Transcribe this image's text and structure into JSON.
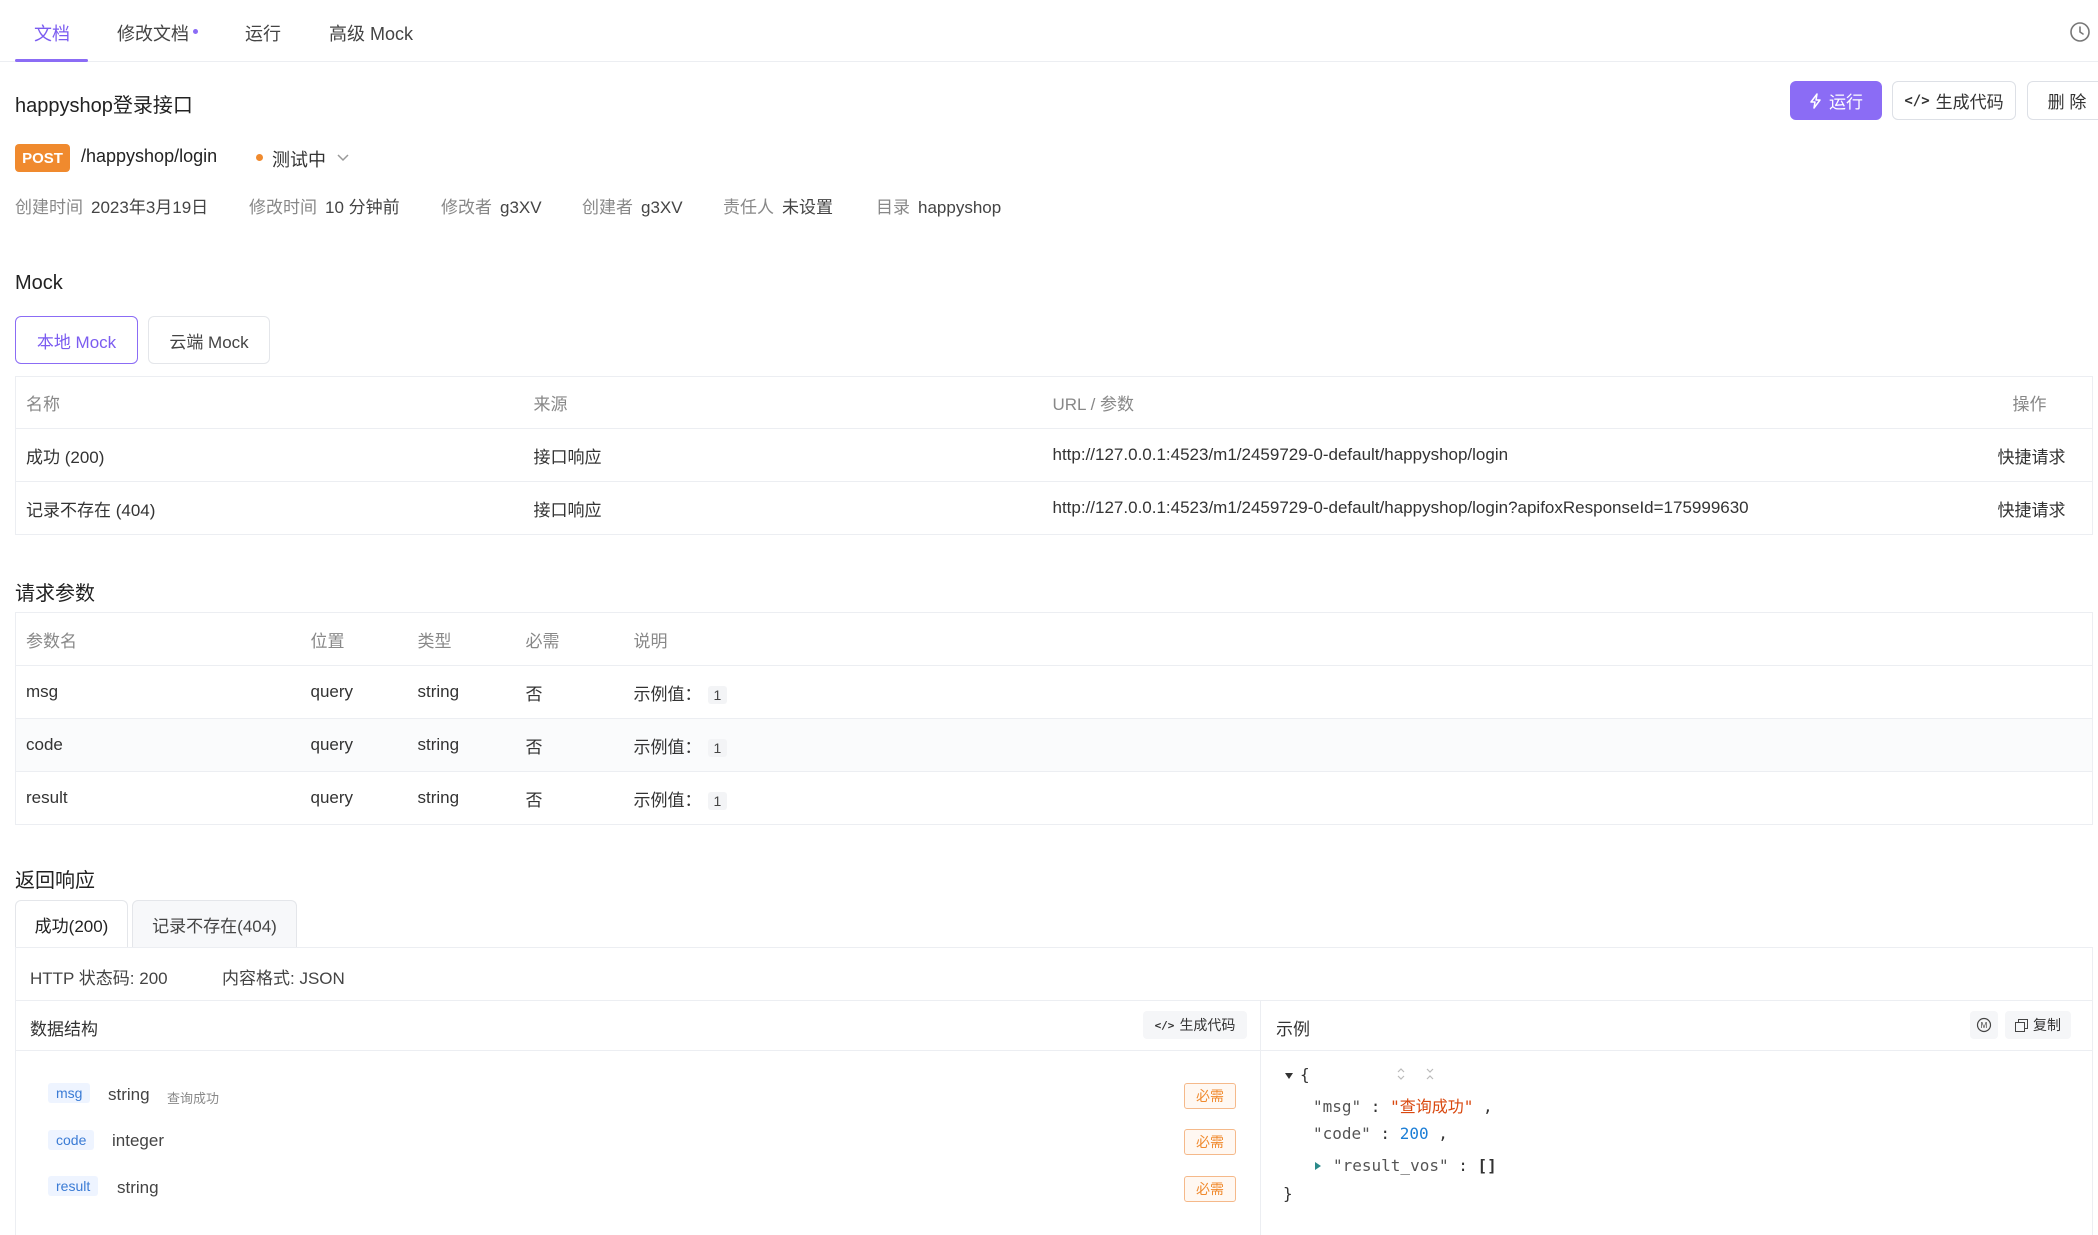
{
  "tabs": [
    {
      "label": "文档",
      "active": true
    },
    {
      "label": "修改文档",
      "modified": true
    },
    {
      "label": "运行"
    },
    {
      "label": "高级 Mock"
    }
  ],
  "api": {
    "title": "happyshop登录接口",
    "method": "POST",
    "path": "/happyshop/login",
    "status": "测试中"
  },
  "actions": {
    "run": "运行",
    "generate_code": "生成代码",
    "delete": "删 除"
  },
  "meta": [
    {
      "label": "创建时间",
      "value": "2023年3月19日"
    },
    {
      "label": "修改时间",
      "value": "10 分钟前"
    },
    {
      "label": "修改者",
      "value": "g3XV"
    },
    {
      "label": "创建者",
      "value": "g3XV"
    },
    {
      "label": "责任人",
      "value": "未设置"
    },
    {
      "label": "目录",
      "value": "happyshop"
    }
  ],
  "mock": {
    "title": "Mock",
    "segments": [
      "本地 Mock",
      "云端 Mock"
    ],
    "columns": [
      "名称",
      "来源",
      "URL / 参数",
      "操作"
    ],
    "rows": [
      {
        "name": "成功 (200)",
        "source": "接口响应",
        "url": "http://127.0.0.1:4523/m1/2459729-0-default/happyshop/login",
        "action": "快捷请求"
      },
      {
        "name": "记录不存在 (404)",
        "source": "接口响应",
        "url": "http://127.0.0.1:4523/m1/2459729-0-default/happyshop/login?apifoxResponseId=175999630",
        "action": "快捷请求"
      }
    ]
  },
  "params": {
    "title": "请求参数",
    "columns": [
      "参数名",
      "位置",
      "类型",
      "必需",
      "说明"
    ],
    "rows": [
      {
        "name": "msg",
        "in": "query",
        "type": "string",
        "required": "否",
        "desc_label": "示例值：",
        "example": "1"
      },
      {
        "name": "code",
        "in": "query",
        "type": "string",
        "required": "否",
        "desc_label": "示例值：",
        "example": "1"
      },
      {
        "name": "result",
        "in": "query",
        "type": "string",
        "required": "否",
        "desc_label": "示例值：",
        "example": "1"
      }
    ]
  },
  "response": {
    "title": "返回响应",
    "tabs": [
      "成功(200)",
      "记录不存在(404)"
    ],
    "http_status": "HTTP 状态码: 200",
    "content_type": "内容格式: JSON",
    "schema_title": "数据结构",
    "schema_gen": "生成代码",
    "example_title": "示例",
    "copy": "复制",
    "fields": [
      {
        "name": "msg",
        "type": "string",
        "desc": "查询成功",
        "required": "必需"
      },
      {
        "name": "code",
        "type": "integer",
        "desc": "",
        "required": "必需"
      },
      {
        "name": "result",
        "type": "string",
        "desc": "",
        "required": "必需"
      }
    ],
    "example": {
      "open": "{",
      "close": "}",
      "msg_key": "\"msg\"",
      "msg_val": "\"查询成功\"",
      "code_key": "\"code\"",
      "code_val": "200",
      "result_key": "\"result_vos\"",
      "result_val": "[]"
    }
  }
}
